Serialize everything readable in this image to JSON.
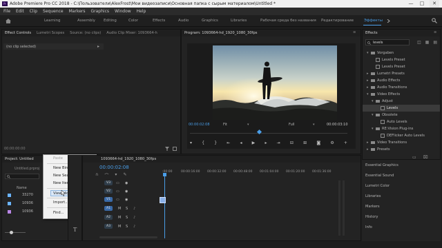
{
  "window": {
    "title": "Adobe Premiere Pro CC 2018 - C:\\Пользователи\\AlexFrost\\Мои видеозаписи\\Основная папка с сырым материалом\\Untitled *",
    "app_icon": "Pr",
    "minimize": "—",
    "maximize": "□",
    "close": "✕"
  },
  "menu": [
    "File",
    "Edit",
    "Clip",
    "Sequence",
    "Markers",
    "Graphics",
    "Window",
    "Help"
  ],
  "workspaces": [
    "Learning",
    "Assembly",
    "Editing",
    "Color",
    "Effects",
    "Audio",
    "Graphics",
    "Libraries",
    "Рабочая среда без названия",
    "Редактирование",
    "Эффекты"
  ],
  "source_panel": {
    "tabs": [
      "Effect Controls",
      "Lumetri Scopes",
      "Source: (no clips)",
      "Audio Clip Mixer: 1093664-h"
    ],
    "no_clip": "(no clip selected)",
    "timecode": "00:00:00:00"
  },
  "program": {
    "title": "Program: 1093664-hd_1920_1080_30fps",
    "timecode": "00:00:02:08",
    "fit": "Fit",
    "quality": "Full",
    "duration": "00:00:03:10"
  },
  "project": {
    "tab": "Project: Untitled",
    "file": "Untitled.prproj",
    "column_name": "Name",
    "items": [
      "33270",
      "10936",
      "10936"
    ]
  },
  "context_menu": {
    "items": [
      "Paste",
      "New Bin",
      "New Search Bin",
      "New Item",
      "View Hidden",
      "Import...",
      "Find..."
    ],
    "submenu_arrow": "▸"
  },
  "timeline": {
    "sequence": "1093664-hd_1920_1080_30fps",
    "timecode": "00:00:02:08",
    "ruler": [
      ":00:00",
      "00:00:16:00",
      "00:00:32:00",
      "00:00:48:00",
      "00:01:04:00",
      "00:01:20:00",
      "00:01:36:00"
    ],
    "video_tracks": [
      "V3",
      "V2",
      "V1"
    ],
    "audio_tracks": [
      "A1",
      "A2",
      "A3"
    ],
    "mute": "M",
    "solo": "S"
  },
  "effects": {
    "title": "Effects",
    "menu_icon": "≡",
    "search": "levels",
    "tree": [
      {
        "label": "Vorgaben",
        "indent": 0,
        "kind": "folder",
        "open": true
      },
      {
        "label": "Levels Preset",
        "indent": 1,
        "kind": "item"
      },
      {
        "label": "Levels Preset",
        "indent": 1,
        "kind": "item"
      },
      {
        "label": "Lumetri Presets",
        "indent": 0,
        "kind": "folder"
      },
      {
        "label": "Audio Effects",
        "indent": 0,
        "kind": "folder"
      },
      {
        "label": "Audio Transitions",
        "indent": 0,
        "kind": "folder"
      },
      {
        "label": "Video Effects",
        "indent": 0,
        "kind": "folder",
        "open": true
      },
      {
        "label": "Adjust",
        "indent": 1,
        "kind": "folder",
        "open": true
      },
      {
        "label": "Levels",
        "indent": 2,
        "kind": "item",
        "selected": true
      },
      {
        "label": "Obsolete",
        "indent": 1,
        "kind": "folder",
        "open": true
      },
      {
        "label": "Auto Levels",
        "indent": 2,
        "kind": "item"
      },
      {
        "label": "RE:Vision Plug-ins",
        "indent": 1,
        "kind": "folder",
        "open": true
      },
      {
        "label": "DEFlicker Auto Levels",
        "indent": 2,
        "kind": "item"
      },
      {
        "label": "Video Transitions",
        "indent": 0,
        "kind": "folder"
      },
      {
        "label": "Presets",
        "indent": 0,
        "kind": "folder"
      }
    ],
    "panels": [
      "Essential Graphics",
      "Essential Sound",
      "Lumetri Color",
      "Libraries",
      "Markers",
      "History",
      "Info"
    ]
  },
  "colors": {
    "accent": "#4a9ee8",
    "background": "#1d1d1d",
    "selected": "#3b3b3b"
  }
}
